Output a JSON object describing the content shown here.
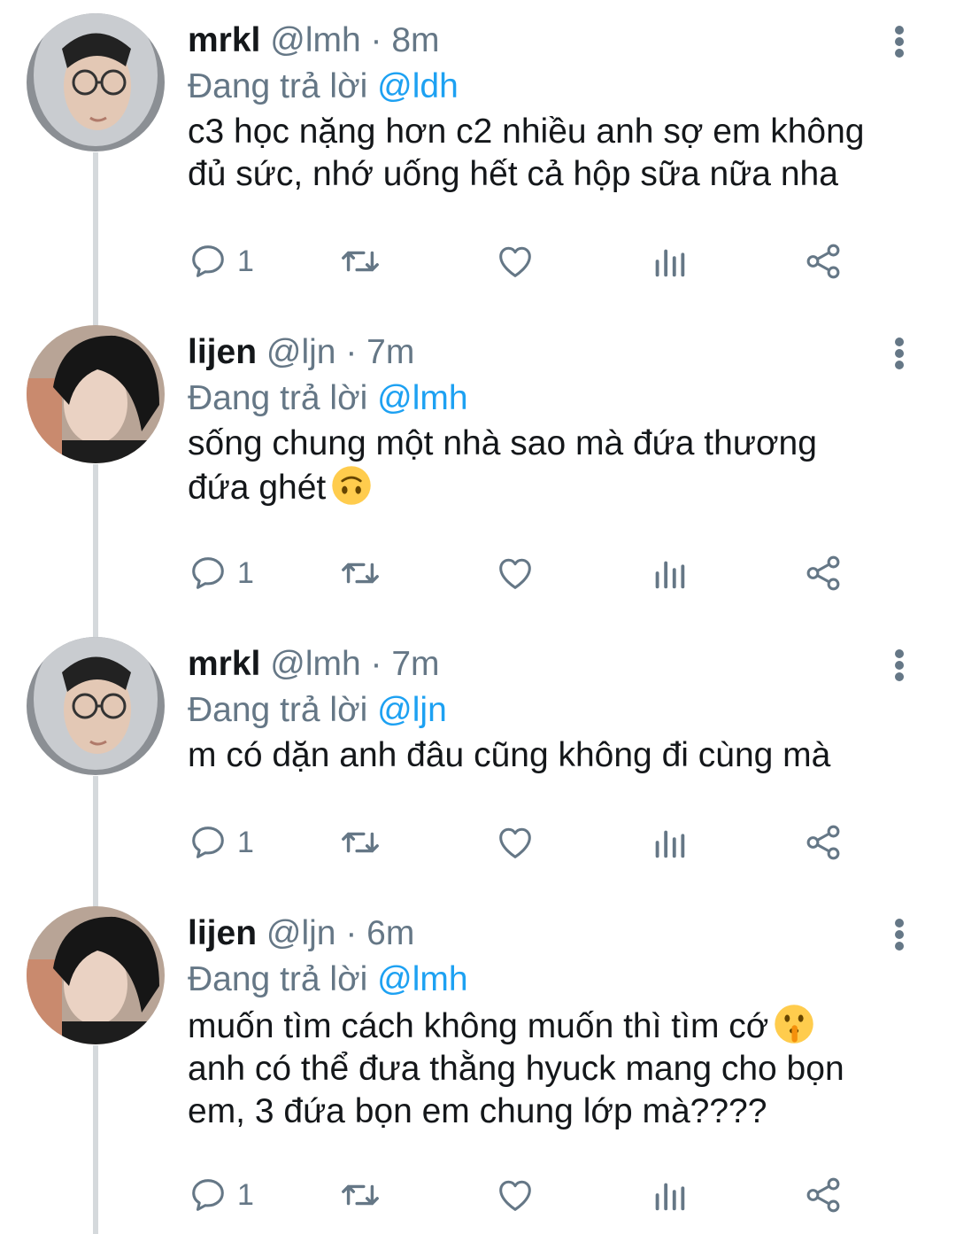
{
  "tweets": [
    {
      "name": "mrkl",
      "handle": "@lmh",
      "sep": "·",
      "time": "8m",
      "reply_prefix": "Đang trả lời",
      "reply_to": "@ldh",
      "text_lines": [
        "c3 học nặng hơn c2 nhiều anh sợ em không",
        "đủ sức, nhớ uống hết cả hộp sữa nữa nha"
      ],
      "reply_count": "1",
      "avatar": "mrkl-avatar"
    },
    {
      "name": "lijen",
      "handle": "@ljn",
      "sep": "·",
      "time": "7m",
      "reply_prefix": "Đang trả lời",
      "reply_to": "@lmh",
      "text_lines": [
        "sống chung một nhà sao mà đứa thương",
        "đứa ghét"
      ],
      "emoji": "upside-down-face-emoji",
      "reply_count": "1",
      "avatar": "lijen-avatar"
    },
    {
      "name": "mrkl",
      "handle": "@lmh",
      "sep": "·",
      "time": "7m",
      "reply_prefix": "Đang trả lời",
      "reply_to": "@ljn",
      "text_lines": [
        "m có dặn anh đâu cũng không đi cùng mà"
      ],
      "reply_count": "1",
      "avatar": "mrkl-avatar"
    },
    {
      "name": "lijen",
      "handle": "@ljn",
      "sep": "·",
      "time": "6m",
      "reply_prefix": "Đang trả lời",
      "reply_to": "@lmh",
      "text_lines": [
        "muốn tìm cách không muốn thì tìm cớ",
        "anh có thể đưa thằng hyuck mang cho bọn",
        "em, 3 đứa bọn em chung lớp mà????"
      ],
      "emoji": "shushing-face-emoji",
      "reply_count": "1",
      "avatar": "lijen-avatar"
    }
  ],
  "colors": {
    "text": "#14171a",
    "muted": "#657786",
    "mention": "#1da1f2",
    "thread_line": "#d5d9dc"
  },
  "icons": [
    "reply-icon",
    "retweet-icon",
    "like-icon",
    "analytics-icon",
    "share-icon",
    "more-options-icon"
  ]
}
